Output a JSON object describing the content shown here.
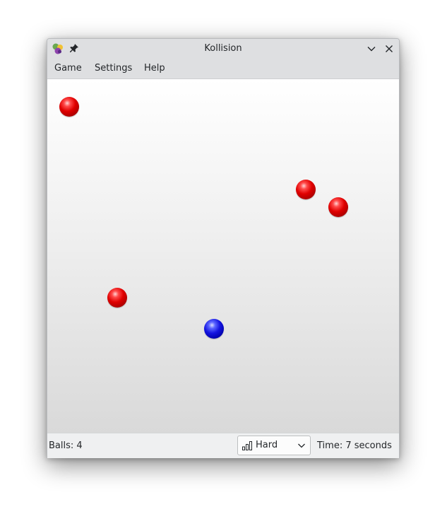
{
  "window": {
    "title": "Kollision",
    "app_icon": "kollision-app-icon",
    "pin_icon": "pin-icon",
    "minimize_icon": "chevron-down-icon",
    "close_icon": "close-icon"
  },
  "menubar": {
    "items": [
      {
        "label": "Game"
      },
      {
        "label": "Settings"
      },
      {
        "label": "Help"
      }
    ]
  },
  "playfield": {
    "balls": [
      {
        "color": "red"
      },
      {
        "color": "red"
      },
      {
        "color": "red"
      },
      {
        "color": "red"
      },
      {
        "color": "blue"
      }
    ]
  },
  "statusbar": {
    "balls_text": "Balls: 4",
    "difficulty": {
      "selected": "Hard",
      "icon": "difficulty-bars-icon"
    },
    "time_text": "Time: 7 seconds"
  },
  "colors": {
    "ball_red": "#e00000",
    "ball_blue": "#1414e0",
    "titlebar": "#dedfe1",
    "statusbar": "#eff0f1"
  }
}
